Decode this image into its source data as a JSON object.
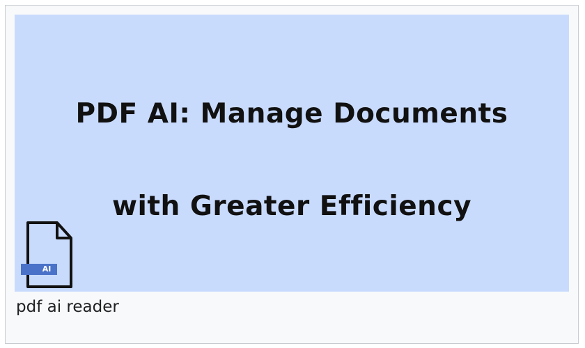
{
  "figure": {
    "banner": {
      "headline_line1": "PDF AI: Manage Documents",
      "headline_line2": "with Greater Efficiency",
      "background_color": "#c9dbfd"
    },
    "file_icon": {
      "icon": "ai-file-icon",
      "badge_text": "AI",
      "badge_color": "#4a72c8"
    },
    "caption": "pdf ai reader"
  }
}
